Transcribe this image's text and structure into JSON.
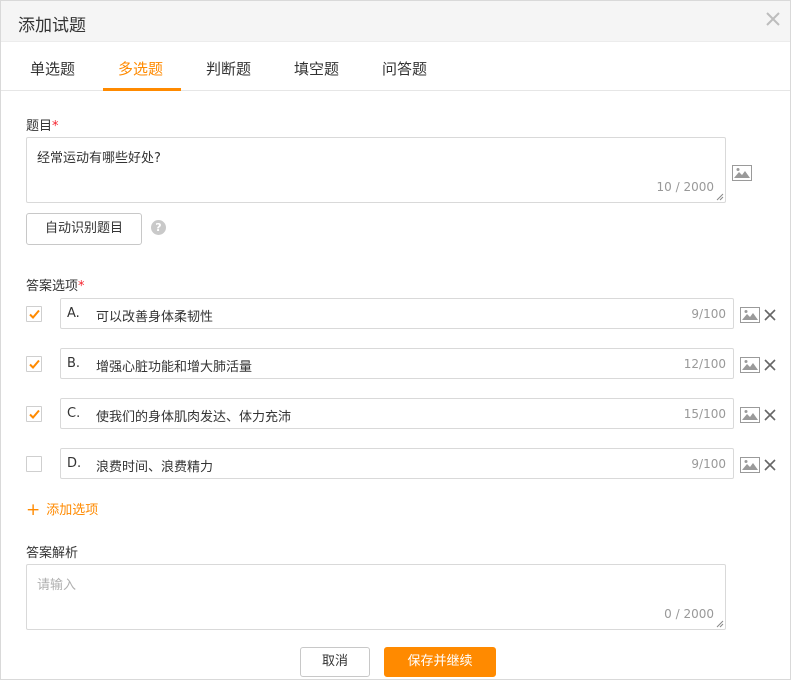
{
  "dialog": {
    "title": "添加试题",
    "close_icon": "close-icon"
  },
  "tabs": [
    {
      "label": "单选题",
      "active": false
    },
    {
      "label": "多选题",
      "active": true
    },
    {
      "label": "判断题",
      "active": false
    },
    {
      "label": "填空题",
      "active": false
    },
    {
      "label": "问答题",
      "active": false
    }
  ],
  "question": {
    "label": "题目",
    "required_mark": "*",
    "value": "经常运动有哪些好处?",
    "counter": "10 / 2000",
    "image_icon": "image-icon"
  },
  "auto_detect_button": "自动识别题目",
  "help_icon_text": "?",
  "options": {
    "label": "答案选项",
    "required_mark": "*",
    "items": [
      {
        "letter": "A.",
        "text": "可以改善身体柔韧性",
        "counter": "9/100",
        "checked": true
      },
      {
        "letter": "B.",
        "text": "增强心脏功能和增大肺活量",
        "counter": "12/100",
        "checked": true
      },
      {
        "letter": "C.",
        "text": "使我们的身体肌肉发达、体力充沛",
        "counter": "15/100",
        "checked": true
      },
      {
        "letter": "D.",
        "text": "浪费时间、浪费精力",
        "counter": "9/100",
        "checked": false
      }
    ]
  },
  "add_option": {
    "plus": "+",
    "label": "添加选项"
  },
  "analysis": {
    "label": "答案解析",
    "placeholder": "请输入",
    "counter": "0 / 2000"
  },
  "footer": {
    "cancel_label": "取消",
    "save_label": "保存并继续"
  },
  "colors": {
    "accent": "#ff8a00",
    "required": "#f5222d"
  }
}
